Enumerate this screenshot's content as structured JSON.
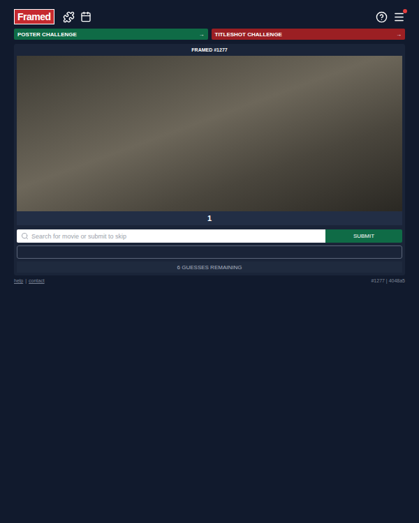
{
  "header": {
    "logo": "Framed",
    "menu_notification": true
  },
  "challenges": [
    {
      "label": "POSTER CHALLENGE",
      "arrow": "→",
      "color": "#0f6b46"
    },
    {
      "label": "TITLESHOT CHALLENGE",
      "arrow": "→",
      "color": "#9b1f23"
    }
  ],
  "card": {
    "title": "FRAMED #1277"
  },
  "frames": [
    {
      "label": "1",
      "selected": true
    }
  ],
  "search": {
    "placeholder": "Search for movie or submit to skip",
    "button": "SUBMIT"
  },
  "guesses": [],
  "remaining": "6 GUESSES REMAINING",
  "footer": {
    "links": [
      "help",
      "contact"
    ],
    "separator": "|",
    "info": "#1277 | 4048a5"
  }
}
